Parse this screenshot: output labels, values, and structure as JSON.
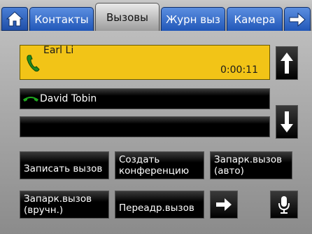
{
  "tabs": {
    "home_icon": "home-icon",
    "items": [
      {
        "label": "Контакты"
      },
      {
        "label": "Вызовы"
      },
      {
        "label": "Журн выз"
      },
      {
        "label": "Камера"
      }
    ],
    "more_icon": "arrow-right-icon"
  },
  "active_call": {
    "icon": "handset-icon",
    "name": "Earl Li",
    "duration": "0:00:11",
    "color": "#f2c417"
  },
  "held_call": {
    "icon": "handset-icon",
    "name": "David Tobin"
  },
  "navigation": {
    "up_icon": "arrow-up-icon",
    "down_icon": "arrow-down-icon"
  },
  "actions": {
    "record": "Записать вызов",
    "conference_line1": "Создать",
    "conference_line2": "конференцию",
    "park_auto_line1": "Запарк.вызов",
    "park_auto_line2": "(авто)",
    "park_manual_line1": "Запарк.вызов",
    "park_manual_line2": "(вручн.)",
    "redirect": "Переадр.вызов",
    "next_icon": "arrow-right-icon",
    "mic_icon": "microphone-icon"
  }
}
